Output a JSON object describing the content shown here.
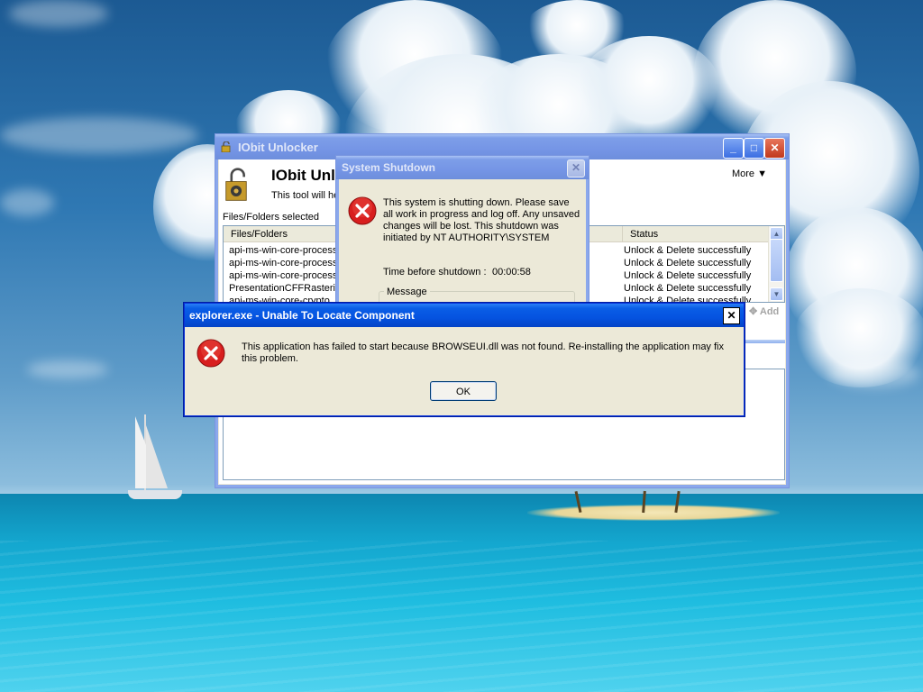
{
  "colors": {
    "xp_title_active": "#0553e0",
    "xp_title_inactive": "#7595e6",
    "dialog_face": "#ece9d8",
    "error_red": "#d81e1e"
  },
  "iobit": {
    "title": "IObit Unlocker",
    "app_name": "IObit Unl",
    "subtitle": "This tool will he",
    "more_label": "More",
    "files_selected_label": "Files/Folders selected",
    "columns": {
      "files": "Files/Folders",
      "status": "Status"
    },
    "rows": [
      {
        "file": "api-ms-win-core-processe",
        "status": "Unlock & Delete successfully"
      },
      {
        "file": "api-ms-win-core-processt",
        "status": "Unlock & Delete successfully"
      },
      {
        "file": "api-ms-win-core-processt",
        "status": "Unlock & Delete successfully"
      },
      {
        "file": "PresentationCFFRasteriz",
        "status": "Unlock & Delete successfully"
      },
      {
        "file": "api-ms-win-core-crypto",
        "status": "Unlock & Delete successfully"
      }
    ],
    "add_label": "Add",
    "buttons": {
      "minimize": "_",
      "maximize": "□",
      "close": "✕"
    }
  },
  "shutdown": {
    "title": "System Shutdown",
    "message": "This system is shutting down. Please save all work in progress and log off. Any unsaved changes will be lost. This shutdown was initiated by NT AUTHORITY\\SYSTEM",
    "time_label": "Time before shutdown :",
    "time_value": "00:00:58",
    "message_group_label": "Message"
  },
  "error_dialog": {
    "title": "explorer.exe - Unable To Locate Component",
    "message": "This application has failed to start because BROWSEUI.dll was not found. Re-installing the application may fix this problem.",
    "ok_label": "OK",
    "close_label": "✕"
  },
  "icons": {
    "error": "error-icon",
    "lock": "lock-icon",
    "gear": "gear-icon",
    "add": "add-icon",
    "dropdown": "triangle-down-icon"
  }
}
